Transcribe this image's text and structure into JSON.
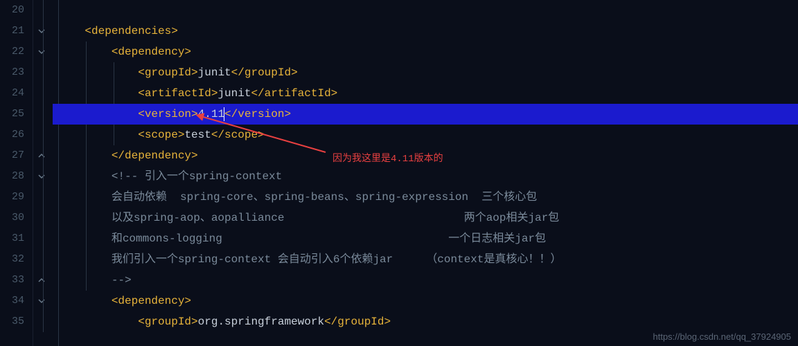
{
  "lines": {
    "20": "",
    "21": "21",
    "22": "22",
    "23": "23",
    "24": "24",
    "25": "25",
    "26": "26",
    "27": "27",
    "28": "28",
    "29": "29",
    "30": "30",
    "31": "31",
    "32": "32",
    "33": "33",
    "34": "34",
    "35": "35"
  },
  "code": {
    "l20": "",
    "l21_open": "<dependencies>",
    "l22_open": "<dependency>",
    "l23_tag_open": "<groupId>",
    "l23_text": "junit",
    "l23_tag_close": "</groupId>",
    "l24_tag_open": "<artifactId>",
    "l24_text": "junit",
    "l24_tag_close": "</artifactId>",
    "l25_tag_open": "<version>",
    "l25_text": "4.11",
    "l25_tag_close": "</version>",
    "l26_tag_open": "<scope>",
    "l26_text": "test",
    "l26_tag_close": "</scope>",
    "l27_close": "</dependency>",
    "l28_comment": "<!-- 引入一个spring-context",
    "l29_comment": "会自动依赖  spring-core、spring-beans、spring-expression  三个核心包",
    "l30_comment": "以及spring-aop、aopalliance                           两个aop相关jar包",
    "l31_comment": "和commons-logging                                  一个日志相关jar包",
    "l32_comment": "我们引入一个spring-context 会自动引入6个依赖jar     （context是真核心！！）",
    "l33_comment": "-->",
    "l34_open": "<dependency>",
    "l35_tag_open": "<groupId>",
    "l35_text": "org.springframework",
    "l35_tag_close": "</groupId>"
  },
  "annotation": {
    "text": "因为我这里是4.11版本的"
  },
  "watermark": "https://blog.csdn.net/qq_37924905",
  "line_numbers": [
    "20",
    "21",
    "22",
    "23",
    "24",
    "25",
    "26",
    "27",
    "28",
    "29",
    "30",
    "31",
    "32",
    "33",
    "34",
    "35"
  ]
}
